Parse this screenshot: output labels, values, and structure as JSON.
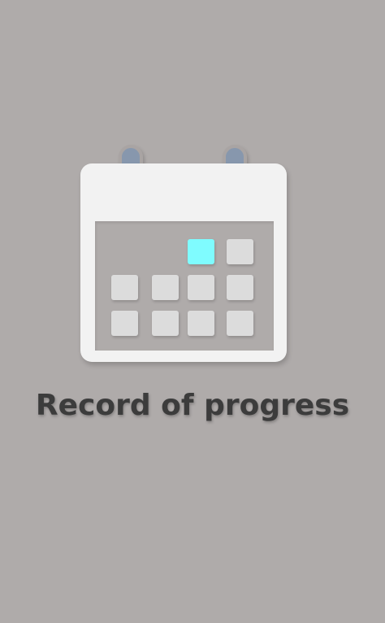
{
  "screen": {
    "title": "Record of progress",
    "illustration": "calendar-icon"
  },
  "colors": {
    "background": "#afabaa",
    "calendar_body": "#f2f2f2",
    "calendar_cell": "#dcdcdc",
    "highlight_cell": "#7ffcff",
    "binder_ring": "#8797ad",
    "title_text": "#3c3c3c"
  }
}
